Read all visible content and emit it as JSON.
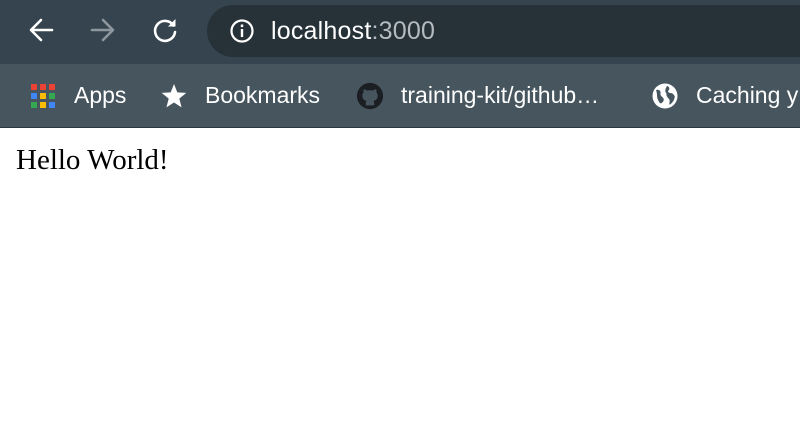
{
  "browser": {
    "toolbar": {
      "back_icon": "arrow-left-icon",
      "forward_icon": "arrow-right-icon",
      "reload_icon": "reload-icon",
      "forward_enabled": false
    },
    "address_bar": {
      "host": "localhost",
      "port": ":3000",
      "security_icon": "info-icon"
    },
    "bookmarks": [
      {
        "label": "Apps",
        "icon": "apps-grid-icon"
      },
      {
        "label": "Bookmarks",
        "icon": "star-icon"
      },
      {
        "label": "training-kit/github…",
        "icon": "github-icon"
      },
      {
        "label": "Caching y",
        "icon": "globe-icon"
      }
    ],
    "colors": {
      "toolbar_bg": "#35444e",
      "omnibox_bg": "#263238",
      "bookmarks_bg": "#46555e",
      "port_text": "#b4bcc1",
      "disabled_icon": "#8d979d"
    }
  },
  "page": {
    "body_text": "Hello World!"
  }
}
